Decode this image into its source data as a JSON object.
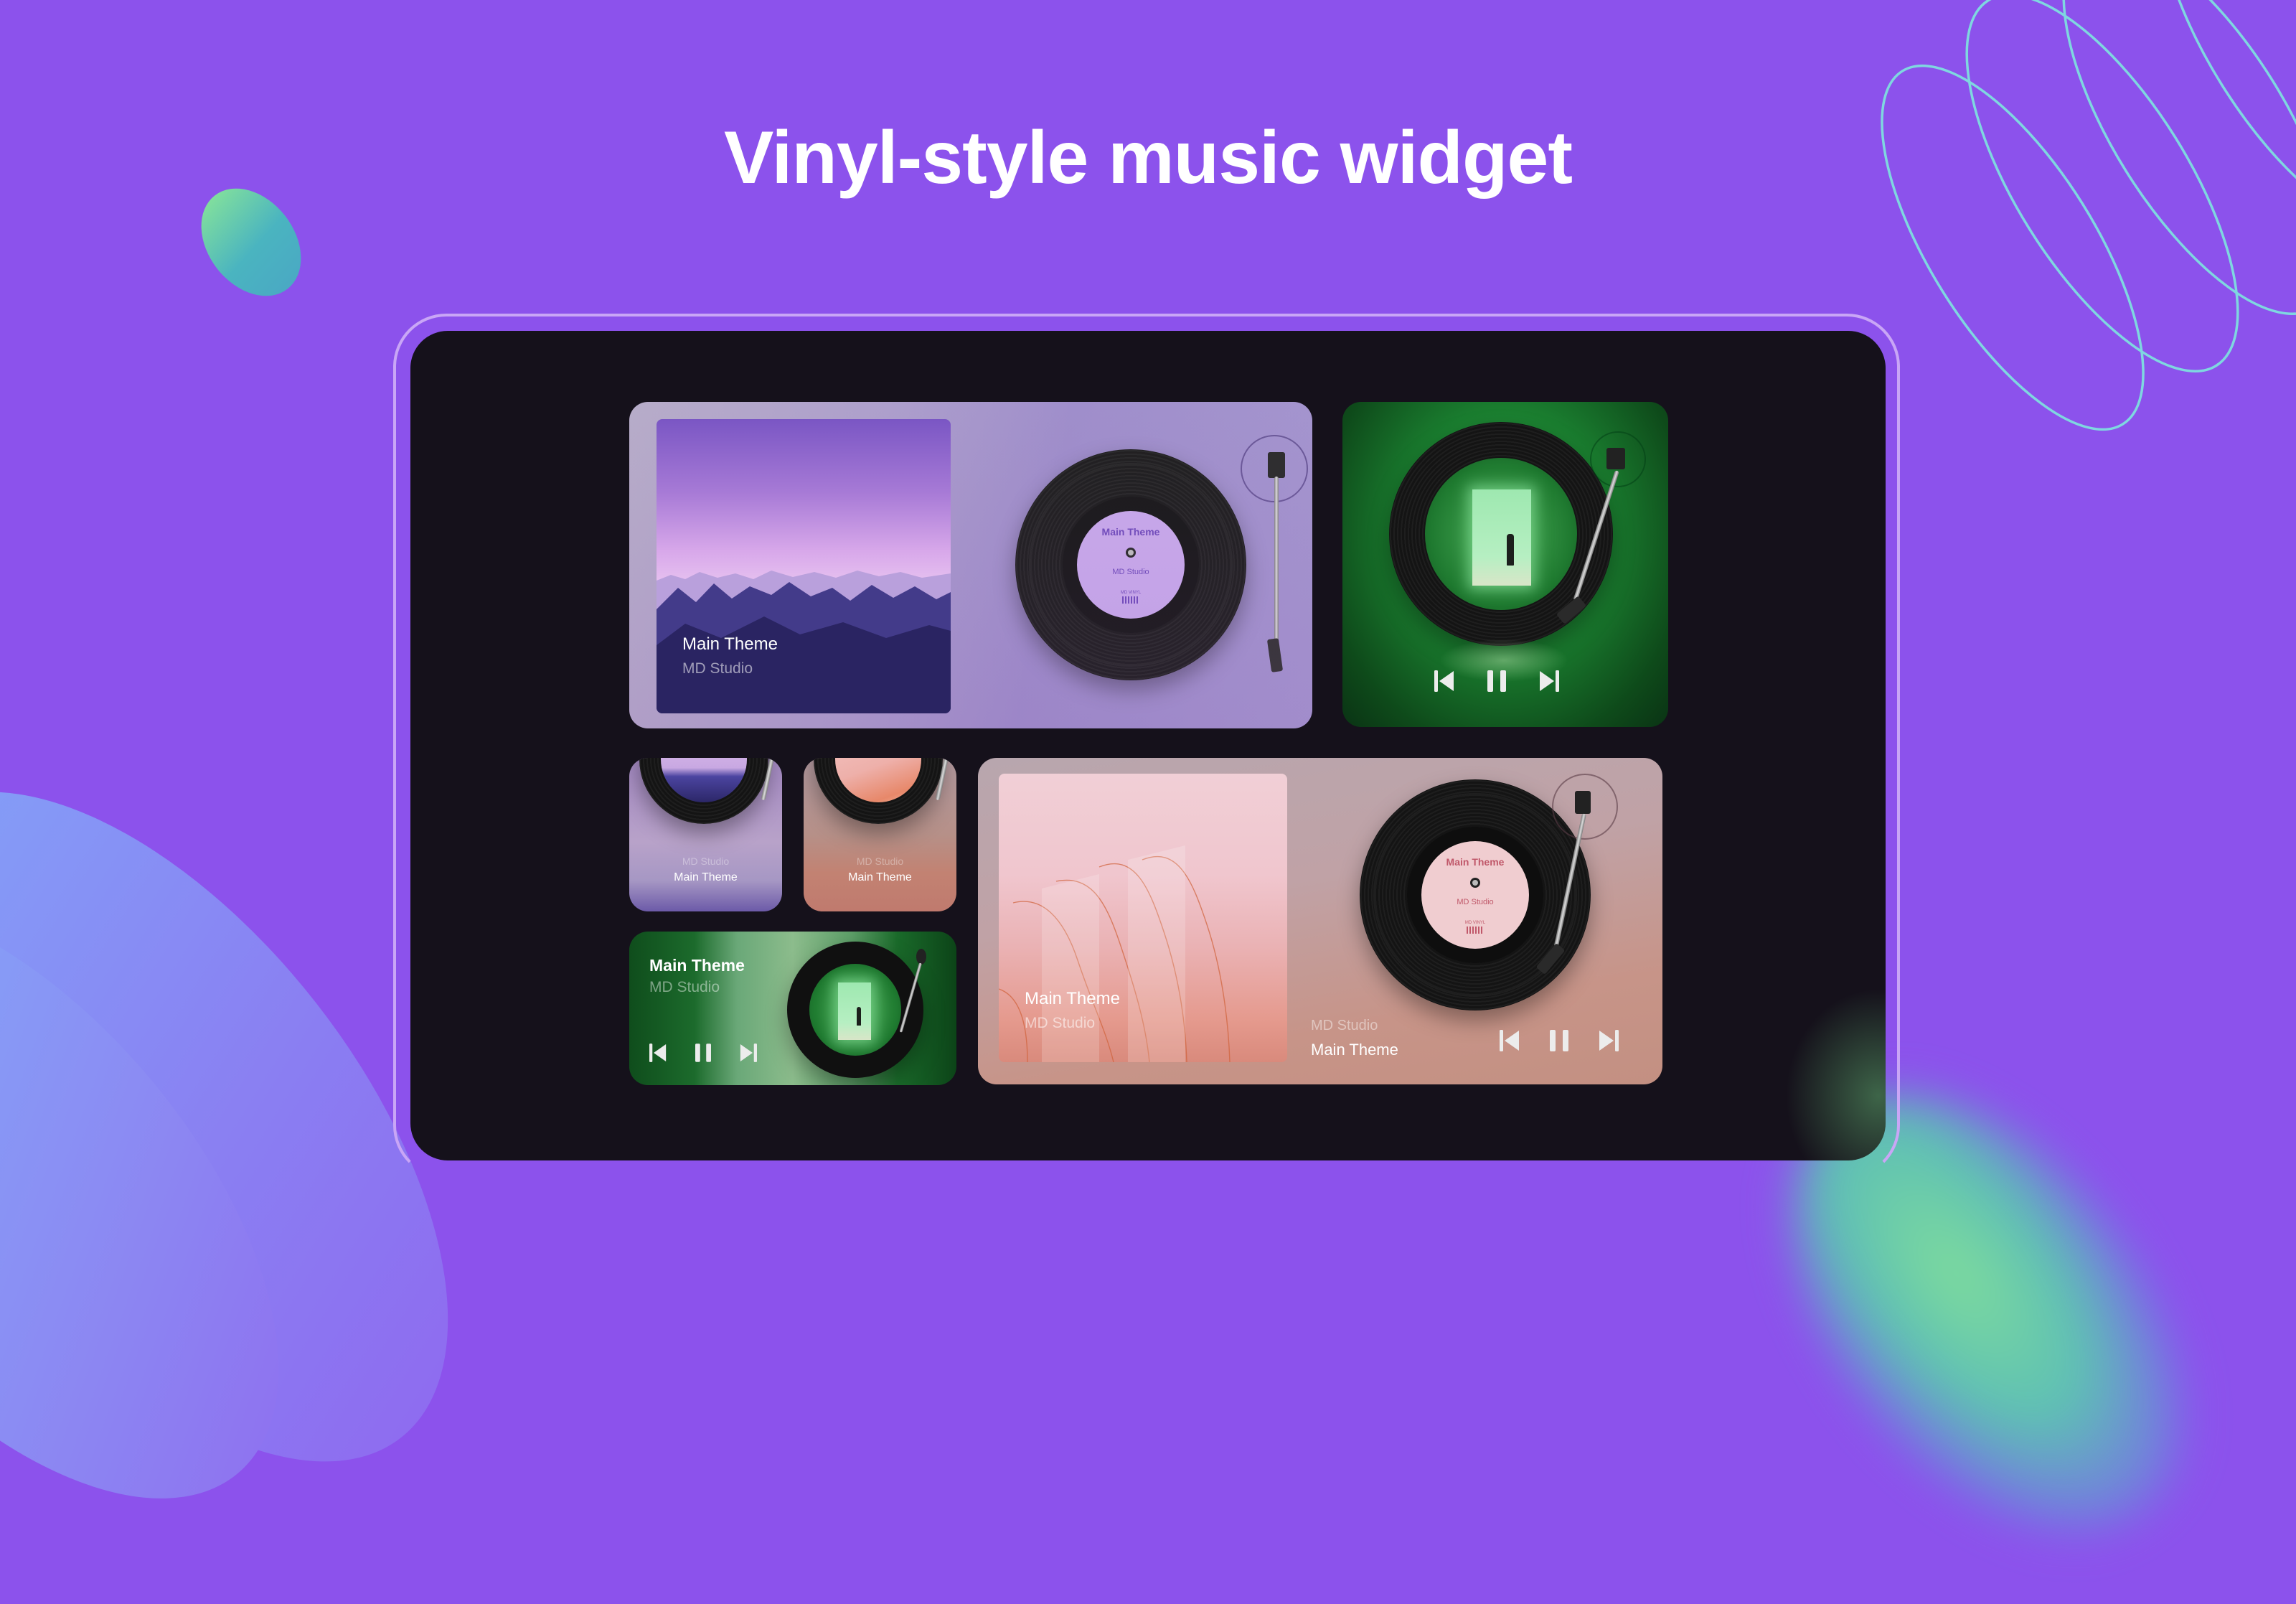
{
  "page": {
    "title": "Vinyl-style music widget",
    "colors": {
      "background": "#8c52ec",
      "screen": "#15111b",
      "accent_teal": "#7fd7e0",
      "accent_green": "#7fdc9c"
    }
  },
  "widgets": {
    "large_lavender": {
      "cover_title": "Main Theme",
      "cover_artist": "MD Studio",
      "label_title": "Main Theme",
      "label_artist": "MD Studio",
      "label_footer": "MD VINYL",
      "label_color": "#c6a6ea",
      "label_text_color": "#6a44b8"
    },
    "square_green": {
      "controls": [
        {
          "icon": "skip-previous-icon",
          "label": "Previous"
        },
        {
          "icon": "pause-icon",
          "label": "Pause"
        },
        {
          "icon": "skip-next-icon",
          "label": "Next"
        }
      ]
    },
    "small_lavender": {
      "artist": "MD Studio",
      "title": "Main Theme"
    },
    "small_peach": {
      "artist": "MD Studio",
      "title": "Main Theme"
    },
    "wide_green": {
      "title": "Main Theme",
      "artist": "MD Studio",
      "controls": [
        {
          "icon": "skip-previous-icon",
          "label": "Previous"
        },
        {
          "icon": "pause-icon",
          "label": "Pause"
        },
        {
          "icon": "skip-next-icon",
          "label": "Next"
        }
      ]
    },
    "large_pink": {
      "cover_title": "Main Theme",
      "cover_artist": "MD Studio",
      "label_title": "Main Theme",
      "label_artist": "MD Studio",
      "label_footer": "MD VINYL",
      "label_color": "#f0cdd0",
      "label_text_color": "#c0586a",
      "info_artist": "MD Studio",
      "info_title": "Main Theme",
      "controls": [
        {
          "icon": "skip-previous-icon",
          "label": "Previous"
        },
        {
          "icon": "pause-icon",
          "label": "Pause"
        },
        {
          "icon": "skip-next-icon",
          "label": "Next"
        }
      ]
    }
  }
}
